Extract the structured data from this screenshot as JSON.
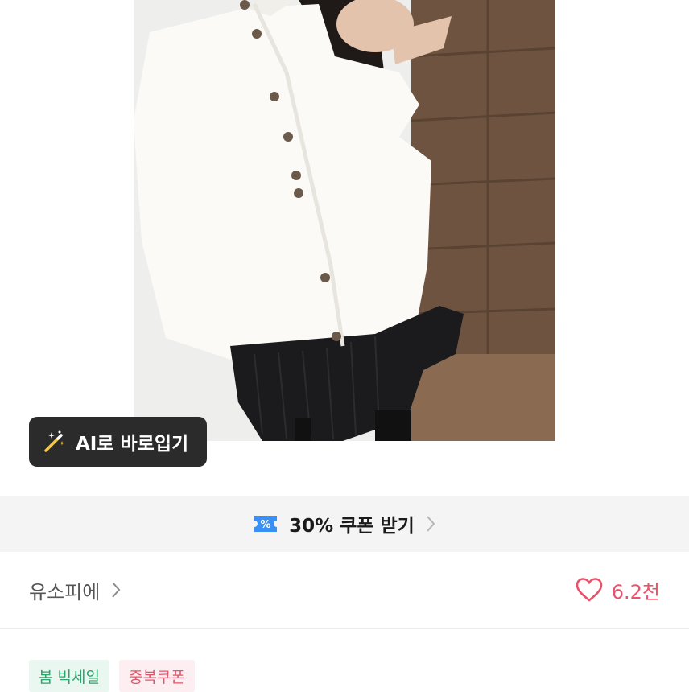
{
  "ai_button": {
    "label": "AI로 바로입기",
    "icon": "magic-wand-icon"
  },
  "coupon": {
    "label": "30% 쿠폰 받기",
    "icon": "coupon-ticket-icon",
    "icon_color": "#3a8ff5"
  },
  "store": {
    "name": "유소피에"
  },
  "likes": {
    "count": "6.2천",
    "icon": "heart-icon",
    "color": "#e8536b"
  },
  "tags": [
    {
      "label": "봄 빅세일"
    },
    {
      "label": "중복쿠폰"
    }
  ]
}
